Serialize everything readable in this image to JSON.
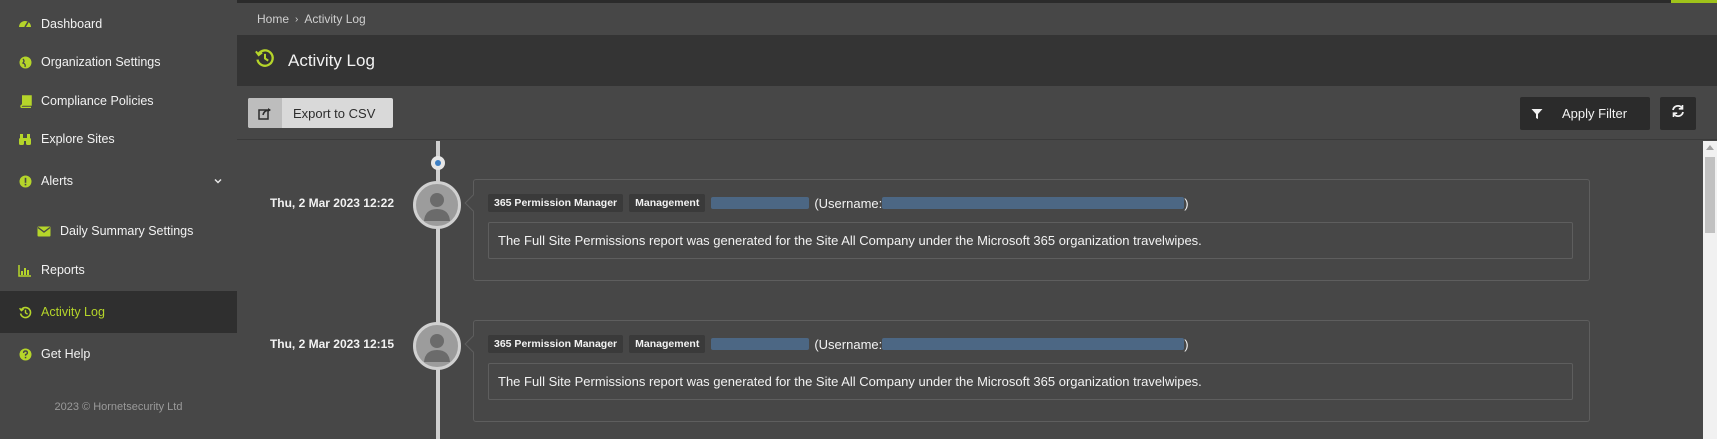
{
  "sidebar": {
    "items": [
      {
        "label": "Dashboard",
        "icon": "dashboard-icon"
      },
      {
        "label": "Organization Settings",
        "icon": "globe-icon"
      },
      {
        "label": "Compliance Policies",
        "icon": "book-icon"
      },
      {
        "label": "Explore Sites",
        "icon": "binoculars-icon"
      },
      {
        "label": "Alerts",
        "icon": "alert-icon"
      },
      {
        "label": "Daily Summary Settings",
        "icon": "envelope-icon"
      },
      {
        "label": "Reports",
        "icon": "bar-chart-icon"
      },
      {
        "label": "Activity Log",
        "icon": "history-icon",
        "active": true
      },
      {
        "label": "Get Help",
        "icon": "help-icon"
      }
    ],
    "footer": "2023 © Hornetsecurity Ltd"
  },
  "breadcrumb": {
    "home": "Home",
    "current": "Activity Log"
  },
  "header": {
    "title": "Activity Log"
  },
  "toolbar": {
    "export_label": "Export to CSV",
    "filter_label": "Apply Filter"
  },
  "entries": [
    {
      "date": "Thu, 2 Mar 2023 12:22",
      "badge1": "365 Permission Manager",
      "badge2": "Management",
      "username_prefix": "(Username:",
      "username_suffix": ")",
      "message": "The Full Site Permissions report was generated for the Site All Company under the Microsoft 365 organization travelwipes."
    },
    {
      "date": "Thu, 2 Mar 2023 12:15",
      "badge1": "365 Permission Manager",
      "badge2": "Management",
      "username_prefix": "(Username:",
      "username_suffix": ")",
      "message": "The Full Site Permissions report was generated for the Site All Company under the Microsoft 365 organization travelwipes."
    }
  ],
  "colors": {
    "accent": "#b5d52a",
    "sidebar_bg": "#474747",
    "active_bg": "#2f2f2f",
    "title_bar": "#343434"
  }
}
